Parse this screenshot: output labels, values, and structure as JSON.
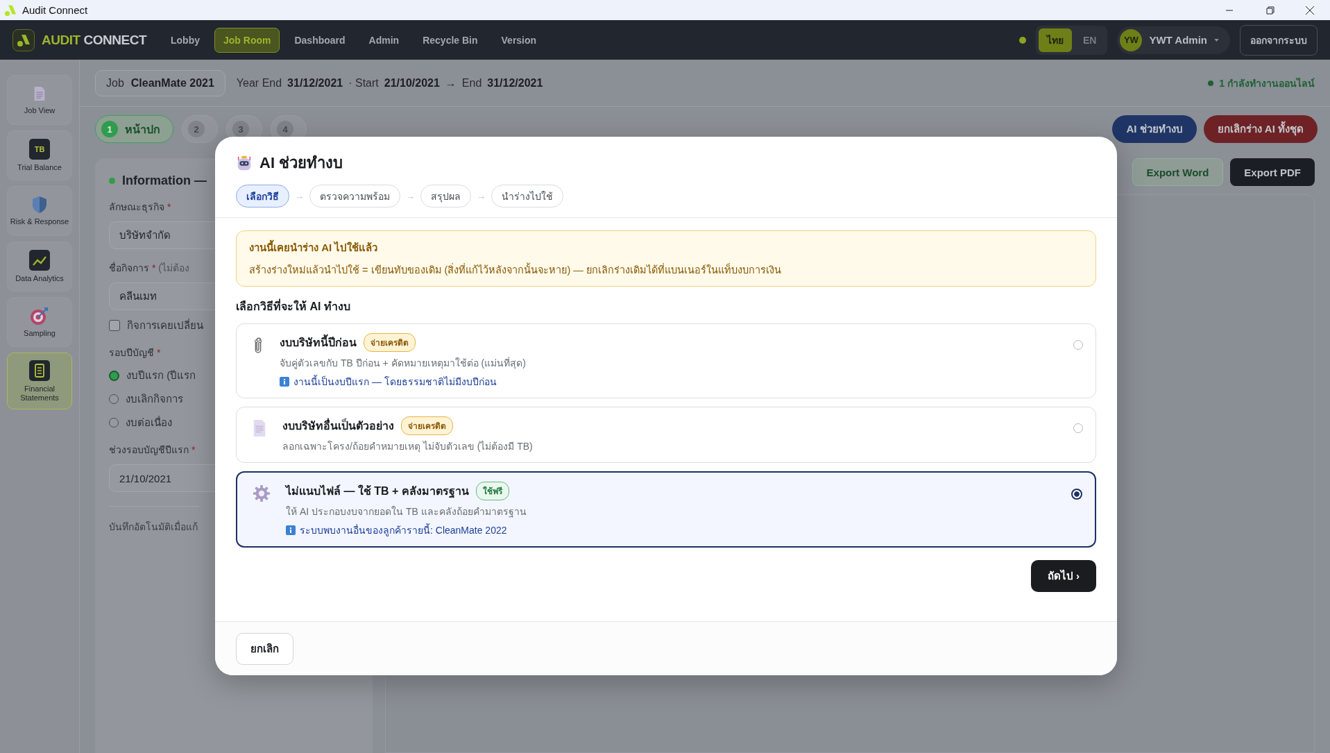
{
  "window": {
    "title": "Audit Connect"
  },
  "navbar": {
    "logo_primary": "AUDIT",
    "logo_secondary": "CONNECT",
    "items": [
      {
        "label": "Lobby",
        "selected": false
      },
      {
        "label": "Job Room",
        "selected": true
      },
      {
        "label": "Dashboard",
        "selected": false
      },
      {
        "label": "Admin",
        "selected": false
      },
      {
        "label": "Recycle Bin",
        "selected": false
      },
      {
        "label": "Version",
        "selected": false
      }
    ],
    "languages": [
      {
        "label": "ไทย",
        "selected": true
      },
      {
        "label": "EN",
        "selected": false
      }
    ],
    "user": {
      "initials": "YW",
      "name": "YWT Admin"
    },
    "logout": "ออกจากระบบ"
  },
  "sidebar": {
    "items": [
      {
        "label": "Job View",
        "kind": "document",
        "selected": false
      },
      {
        "label": "Trial Balance",
        "kind": "tb",
        "badge": "TB",
        "selected": false
      },
      {
        "label": "Risk & Response",
        "kind": "shield",
        "selected": false
      },
      {
        "label": "Data Analytics",
        "kind": "chart",
        "selected": false
      },
      {
        "label": "Sampling",
        "kind": "target",
        "selected": false
      },
      {
        "label": "Financial Statements",
        "kind": "report",
        "selected": true
      }
    ]
  },
  "job_bar": {
    "job_label": "Job",
    "job_name": "CleanMate 2021",
    "year_end_label": "Year End",
    "year_end": "31/12/2021",
    "start_label": "· Start",
    "start": "21/10/2021",
    "arrow": "→",
    "end_label": "End",
    "end": "31/12/2021",
    "online": "1 กำลังทำงานออนไลน์"
  },
  "steps": [
    {
      "number": "1",
      "label": "หน้าปก",
      "selected": true
    },
    {
      "number": "2",
      "selected": false
    },
    {
      "number": "3",
      "selected": false
    },
    {
      "number": "4",
      "selected": false
    }
  ],
  "actions": [
    {
      "label": "AI ช่วยทำงบ",
      "kind": "primary"
    },
    {
      "label": "ยกเลิกร่าง AI ทั้งชุด",
      "kind": "danger"
    }
  ],
  "exports": [
    {
      "label": "Export Word",
      "kind": "outline"
    },
    {
      "label": "Export PDF",
      "kind": "dark"
    }
  ],
  "form": {
    "title": "Information —",
    "items": [
      {
        "kind": "label",
        "text": "ลักษณะธุรกิจ",
        "mark": "*"
      },
      {
        "kind": "input",
        "value": "บริษัทจำกัด"
      },
      {
        "kind": "label",
        "text": "ชื่อกิจการ",
        "mark": "*",
        "hint": "(ไม่ต้อง"
      },
      {
        "kind": "input",
        "value": "คลีนเมท"
      },
      {
        "kind": "checkbox",
        "text": "กิจการเคยเปลี่ยน",
        "checked": false
      },
      {
        "kind": "label",
        "text": "รอบปีบัญชี",
        "mark": "*"
      },
      {
        "kind": "radio",
        "text": "งบปีแรก (ปีแรก",
        "selected": true
      },
      {
        "kind": "radio",
        "text": "งบเลิกกิจการ",
        "selected": false
      },
      {
        "kind": "radio",
        "text": "งบต่อเนื่อง",
        "selected": false
      },
      {
        "kind": "label",
        "text": "ช่วงรอบบัญชีปีแรก",
        "mark": "*"
      },
      {
        "kind": "input",
        "value": "21/10/2021"
      },
      {
        "kind": "note",
        "text": "บันทึกอัตโนมัติเมื่อแก้"
      }
    ]
  },
  "modal": {
    "title": "AI ช่วยทำงบ",
    "steps": [
      {
        "label": "เลือกวิธี",
        "selected": true
      },
      {
        "arrow": "→",
        "label": "ตรวจความพร้อม",
        "selected": false
      },
      {
        "arrow": "→",
        "label": "สรุปผล",
        "selected": false
      },
      {
        "arrow": "→",
        "label": "นำร่างไปใช้",
        "selected": false
      }
    ],
    "notice": {
      "title": "งานนี้เคยนำร่าง AI ไปใช้แล้ว",
      "text": "สร้างร่างใหม่แล้วนำไปใช้ = เขียนทับของเดิม (สิ่งที่แก้ไว้หลังจากนั้นจะหาย) — ยกเลิกร่างเดิมได้ที่แบนเนอร์ในแท็บงบการเงิน"
    },
    "section_title": "เลือกวิธีที่จะให้ AI ทำงบ",
    "options": [
      {
        "kind": "paperclip",
        "title": "งบบริษัทนี้ปีก่อน",
        "badge": {
          "text": "จ่ายเครดิต",
          "kind": "credit"
        },
        "description": "จับคู่ตัวเลขกับ TB ปีก่อน + คัดหมายเหตุมาใช้ต่อ (แม่นที่สุด)",
        "note": "งานนี้เป็นงบปีแรก — โดยธรรมชาติไม่มีงบปีก่อน",
        "selected": false
      },
      {
        "kind": "document",
        "title": "งบบริษัทอื่นเป็นตัวอย่าง",
        "badge": {
          "text": "จ่ายเครดิต",
          "kind": "credit"
        },
        "description": "ลอกเฉพาะโครง/ถ้อยคำหมายเหตุ ไม่จับตัวเลข (ไม่ต้องมี TB)",
        "selected": false
      },
      {
        "kind": "gear",
        "title": "ไม่แนบไฟล์ — ใช้ TB + คลังมาตรฐาน",
        "badge": {
          "text": "ใช้ฟรี",
          "kind": "free"
        },
        "description": "ให้ AI ประกอบงบจากยอดใน TB และคลังถ้อยคำมาตรฐาน",
        "note": "ระบบพบงานอื่นของลูกค้ารายนี้: CleanMate 2022",
        "selected": true
      }
    ],
    "next": "ถัดไป ›",
    "cancel": "ยกเลิก"
  }
}
